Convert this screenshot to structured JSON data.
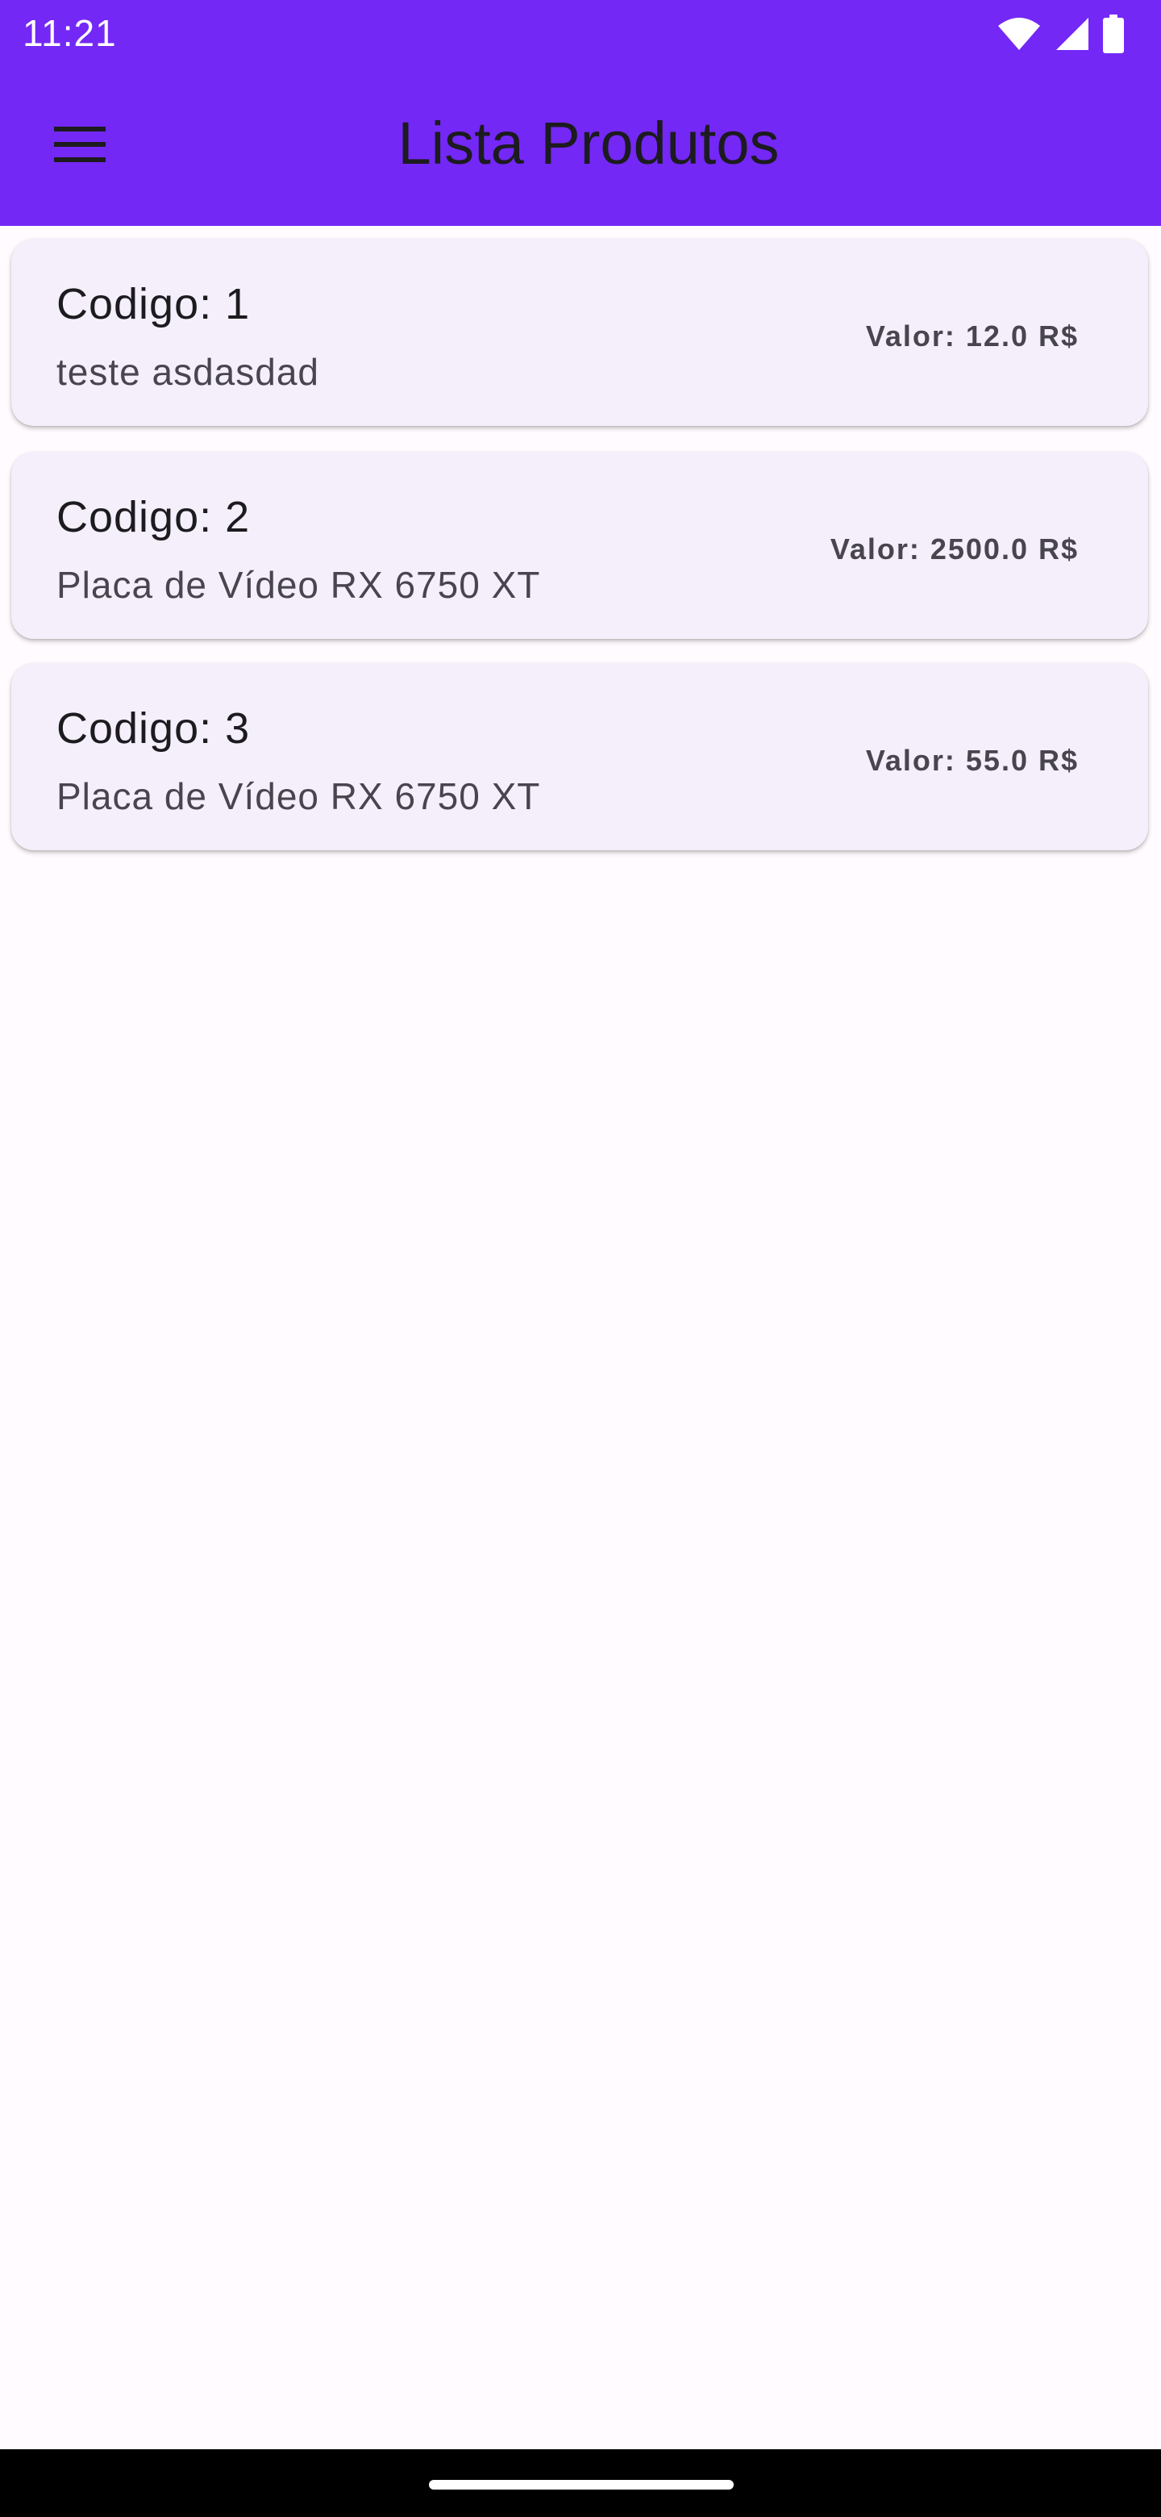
{
  "status_bar": {
    "time": "11:21",
    "icons": [
      "wifi-icon",
      "signal-icon",
      "battery-icon"
    ]
  },
  "app_bar": {
    "title": "Lista Produtos",
    "menu_icon": "hamburger-menu-icon"
  },
  "products": [
    {
      "code": "Codigo: 1",
      "description": "teste asdasdad",
      "price": "Valor: 12.0 R$"
    },
    {
      "code": "Codigo: 2",
      "description": "Placa de Vídeo RX 6750 XT",
      "price": "Valor: 2500.0 R$"
    },
    {
      "code": "Codigo: 3",
      "description": "Placa de Vídeo RX 6750 XT",
      "price": "Valor: 55.0 R$"
    }
  ],
  "colors": {
    "app_bar": "#7428f6",
    "background": "#fffbfe",
    "card": "#f4effa",
    "text_primary": "#1c1b1f",
    "text_secondary": "#49454f"
  }
}
